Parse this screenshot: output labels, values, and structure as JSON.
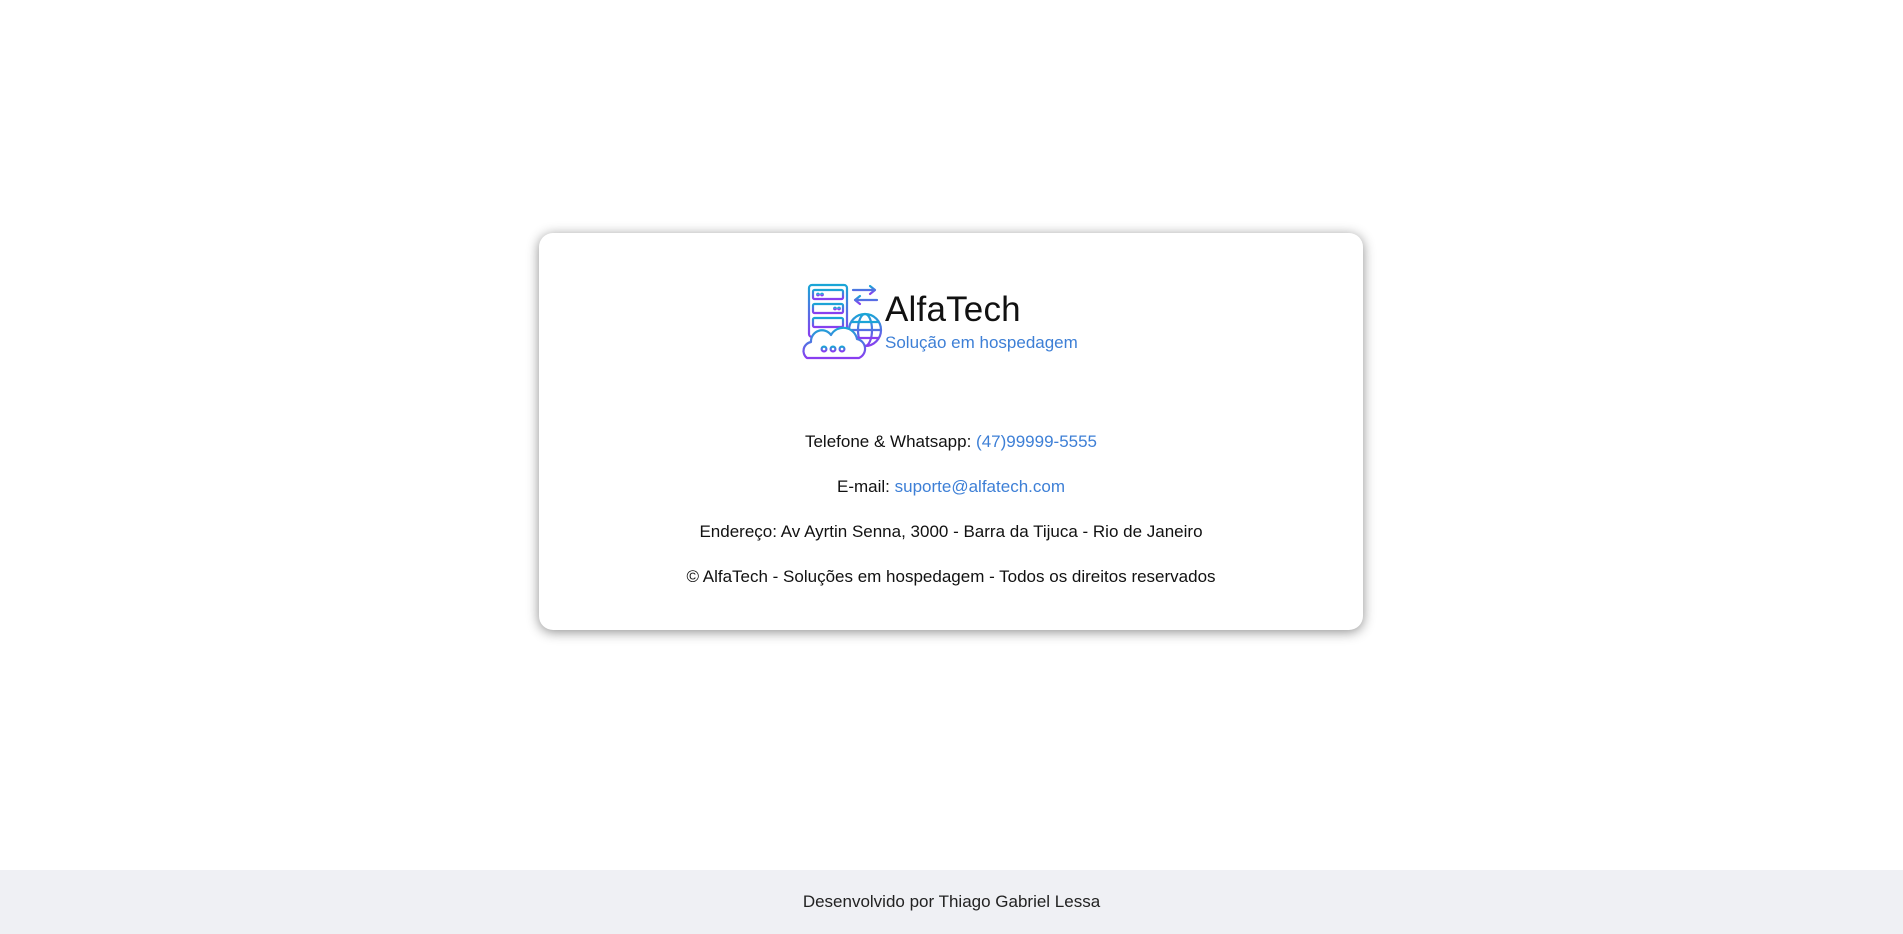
{
  "card": {
    "brand_name": "AlfaTech",
    "brand_tagline": "Solução em hospedagem",
    "logo_icon": "server-cloud-globe-icon",
    "phone_label": "Telefone & Whatsapp:",
    "phone_value": "(47)99999-5555",
    "email_label": "E-mail:",
    "email_value": "suporte@alfatech.com",
    "address": "Endereço: Av Ayrtin Senna, 3000 - Barra da Tijuca - Rio de Janeiro",
    "copyright": "© AlfaTech - Soluções em hospedagem - Todos os direitos reservados"
  },
  "footer": {
    "credit": "Desenvolvido por Thiago Gabriel Lessa"
  },
  "colors": {
    "link": "#3d7fd6",
    "logo_gradient_start": "#1aa6d6",
    "logo_gradient_end": "#8a3df0",
    "footer_bg": "#eff0f4"
  }
}
